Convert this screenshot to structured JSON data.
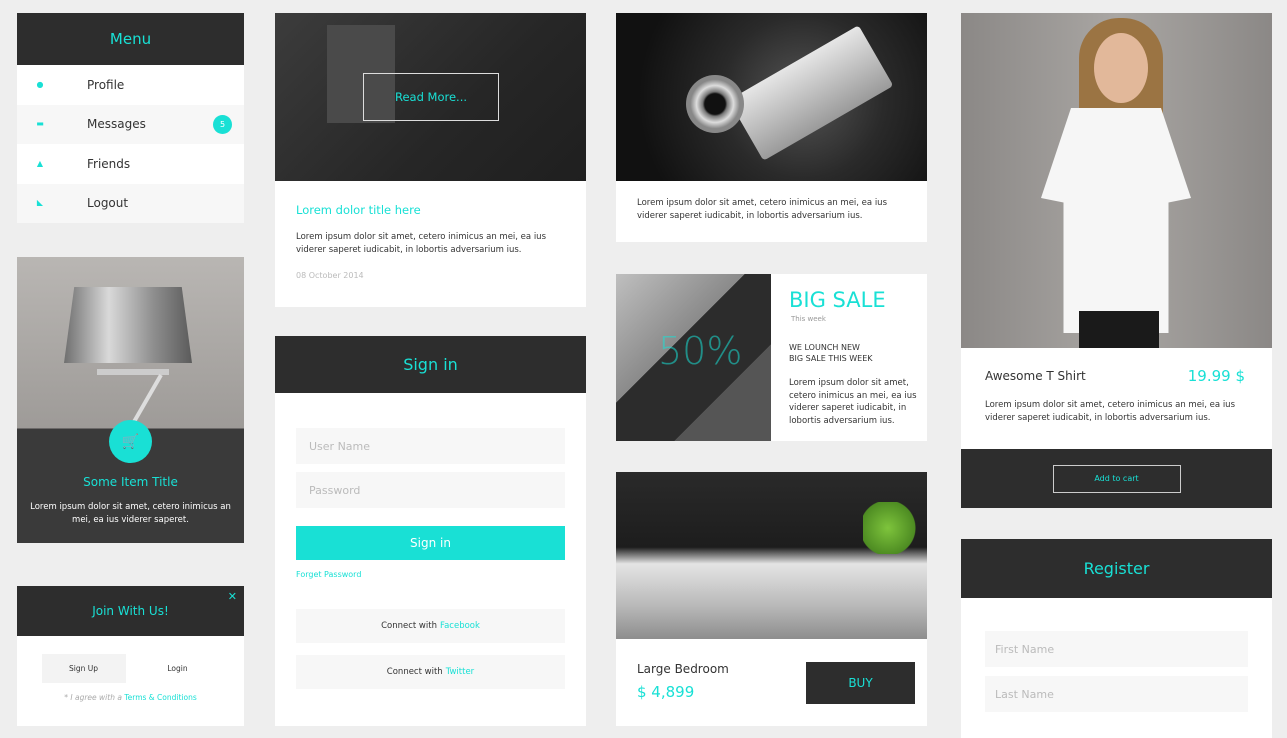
{
  "menu": {
    "title": "Menu",
    "items": [
      {
        "label": "Profile",
        "icon": "globe-icon"
      },
      {
        "label": "Messages",
        "icon": "messages-icon",
        "badge": "5"
      },
      {
        "label": "Friends",
        "icon": "user-icon"
      },
      {
        "label": "Logout",
        "icon": "logout-icon"
      }
    ]
  },
  "lamp_card": {
    "title": "Some Item Title",
    "text": "Lorem ipsum dolor sit amet, cetero inimicus an mei, ea ius viderer saperet."
  },
  "join": {
    "title": "Join With Us!",
    "close": "✕",
    "signup_label": "Sign Up",
    "login_label": "Login",
    "agree_text": "* I agree with a",
    "terms_label": "Terms & Conditions"
  },
  "blog": {
    "read_more": "Read More...",
    "title": "Lorem dolor title here",
    "text": "Lorem ipsum dolor sit amet, cetero inimicus an mei, ea ius viderer saperet iudicabit, in lobortis adversarium ius.",
    "date": "08 October 2014"
  },
  "signin": {
    "title": "Sign in",
    "username_placeholder": "User Name",
    "password_placeholder": "Password",
    "button_label": "Sign in",
    "forgot_label": "Forget Password",
    "connect_prefix": "Connect with",
    "facebook_label": "Facebook",
    "twitter_label": "Twitter"
  },
  "camera_card": {
    "text": "Lorem ipsum dolor sit amet, cetero inimicus an mei, ea ius viderer saperet iudicabit, in lobortis adversarium ius."
  },
  "sale": {
    "percent": "50%",
    "title": "BIG SALE",
    "subtitle": "This week",
    "launch_line1": "WE LOUNCH NEW",
    "launch_line2": "BIG SALE THIS WEEK",
    "text": "Lorem ipsum dolor sit amet, cetero inimicus an mei, ea ius viderer saperet iudicabit, in lobortis adversarium ius."
  },
  "bedroom": {
    "name": "Large Bedroom",
    "price": "$ 4,899",
    "buy_label": "BUY"
  },
  "shirt": {
    "name": "Awesome T Shirt",
    "price": "19.99 $",
    "text": "Lorem ipsum dolor sit amet, cetero inimicus an mei, ea ius viderer saperet iudicabit, in lobortis adversarium ius.",
    "add_label": "Add to cart"
  },
  "register": {
    "title": "Register",
    "first_name_placeholder": "First Name",
    "last_name_placeholder": "Last Name"
  },
  "colors": {
    "accent": "#19e0d5",
    "dark": "#2d2d2d",
    "background": "#eeeeee"
  }
}
